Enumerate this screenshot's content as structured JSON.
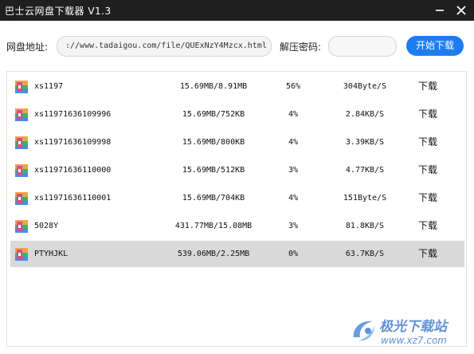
{
  "app": {
    "title": "巴士云网盘下载器 V1.3"
  },
  "toolbar": {
    "url_label": "网盘地址:",
    "url_value": "://www.tadaigou.com/file/QUExNzY4Mzcx.html",
    "password_label": "解压密码:",
    "password_value": "",
    "start_label": "开始下载"
  },
  "downloads": [
    {
      "name": "xs1197",
      "size": "15.69MB/8.91MB",
      "percent": "56%",
      "speed": "304Byte/S",
      "action": "下载"
    },
    {
      "name": "xs11971636109996",
      "size": "15.69MB/752KB",
      "percent": "4%",
      "speed": "2.84KB/S",
      "action": "下载"
    },
    {
      "name": "xs11971636109998",
      "size": "15.69MB/800KB",
      "percent": "4%",
      "speed": "3.39KB/S",
      "action": "下载"
    },
    {
      "name": "xs11971636110000",
      "size": "15.69MB/512KB",
      "percent": "3%",
      "speed": "4.77KB/S",
      "action": "下载"
    },
    {
      "name": "xs11971636110001",
      "size": "15.69MB/704KB",
      "percent": "4%",
      "speed": "151Byte/S",
      "action": "下载"
    },
    {
      "name": "5028Y",
      "size": "431.77MB/15.08MB",
      "percent": "3%",
      "speed": "81.8KB/S",
      "action": "下载"
    },
    {
      "name": "PTYHJKL",
      "size": "539.06MB/2.25MB",
      "percent": "0%",
      "speed": "63.7KB/S",
      "action": "下载"
    }
  ],
  "selected_row": "PTYHJKL",
  "watermark": {
    "text": "极光下载站",
    "url": "www.xz7.com"
  },
  "colors": {
    "titlebar": "#1f1f1f",
    "accent": "#1e7cf0",
    "selected_row": "#d9d9d9"
  },
  "icons": {
    "file": "archive-file-icon",
    "minimize": "minimize-icon",
    "close": "close-icon"
  }
}
